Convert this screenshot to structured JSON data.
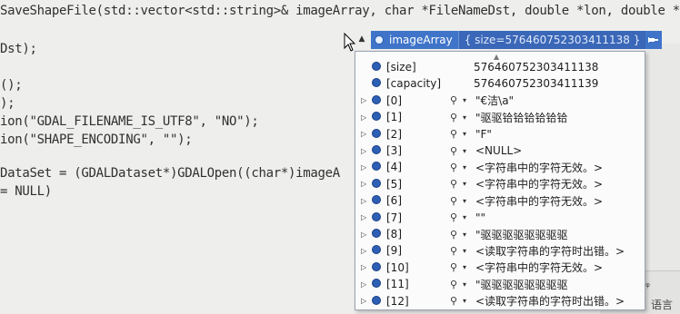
{
  "code": {
    "lines": [
      {
        "text": "SaveShapeFile(std::vector<std::string>& imageArray, char *FileNameDst, double *lon, double *l"
      },
      {
        "text": "Dst);"
      },
      {
        "text": "();"
      },
      {
        "text": ");"
      },
      {
        "text": "ion(\"GDAL_FILENAME_IS_UTF8\", \"NO\");"
      },
      {
        "text": "ion(\"SHAPE_ENCODING\", \"\");"
      },
      {
        "text": "DataSet = (GDALDataset*)GDALOpen((char*)imageA"
      },
      {
        "text": "= NULL)"
      }
    ]
  },
  "datatip": {
    "header": {
      "name": "imageArray",
      "value": "{ size=576460752303411138 }",
      "collapse_glyph": "▲",
      "pin_icon": "pin-icon"
    },
    "rows": [
      {
        "name": "[size]",
        "value": "576460752303411138",
        "expandable": false,
        "viewer": false
      },
      {
        "name": "[capacity]",
        "value": "576460752303411139",
        "expandable": false,
        "viewer": false
      },
      {
        "name": "[0]",
        "value": "\"€洁\\a\"",
        "expandable": true,
        "viewer": true
      },
      {
        "name": "[1]",
        "value": "\"驱驱铪铪铪铪铪铪",
        "expandable": true,
        "viewer": true
      },
      {
        "name": "[2]",
        "value": "\"F\"",
        "expandable": true,
        "viewer": true
      },
      {
        "name": "[3]",
        "value": "<NULL>",
        "expandable": true,
        "viewer": true
      },
      {
        "name": "[4]",
        "value": "<字符串中的字符无效。>",
        "expandable": true,
        "viewer": true
      },
      {
        "name": "[5]",
        "value": "<字符串中的字符无效。>",
        "expandable": true,
        "viewer": true
      },
      {
        "name": "[6]",
        "value": "<字符串中的字符无效。>",
        "expandable": true,
        "viewer": true
      },
      {
        "name": "[7]",
        "value": "\"\"",
        "expandable": true,
        "viewer": true
      },
      {
        "name": "[8]",
        "value": "\"驱驱驱驱驱驱驱驱",
        "expandable": true,
        "viewer": true
      },
      {
        "name": "[9]",
        "value": "<读取字符串的字符时出错。>",
        "expandable": true,
        "viewer": true
      },
      {
        "name": "[10]",
        "value": "<字符串中的字符无效。>",
        "expandable": true,
        "viewer": true
      },
      {
        "name": "[11]",
        "value": "\"驱驱驱驱驱驱驱驱",
        "expandable": true,
        "viewer": true
      },
      {
        "name": "[12]",
        "value": "<读取字符串的字符时出错。>",
        "expandable": true,
        "viewer": true
      }
    ]
  },
  "panel": {
    "dropdown_glyph": "▾",
    "pin_glyph": "ᵩ",
    "language_label": "语言"
  },
  "colors": {
    "header_bg": "#3f74c9",
    "panel_bg": "#fbfbfb"
  }
}
